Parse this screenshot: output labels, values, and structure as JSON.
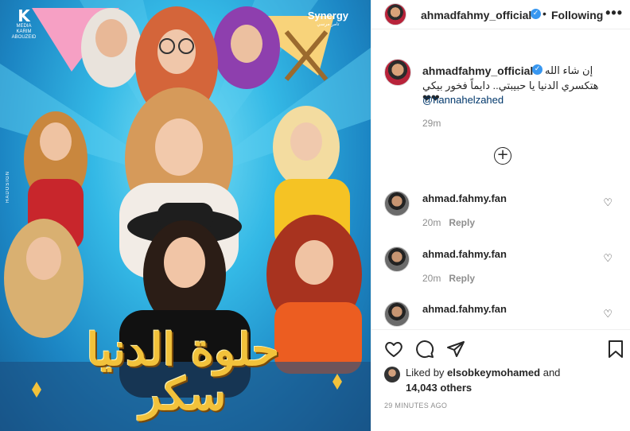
{
  "poster": {
    "brand_left_logo": "K",
    "brand_left_line1": "MEDIA",
    "brand_left_line2": "KARIM ABOUZEID",
    "brand_right_name": "Synergy",
    "brand_right_sub": "تامر مرسي",
    "side_mark": "HADOSIGN",
    "title": "حلوة الدنيا سكر",
    "colors": {
      "sky": "#34b9e6",
      "title_gold": "#f2c23b"
    }
  },
  "header": {
    "username": "ahmadfahmy_official",
    "separator": "•",
    "follow_label": "Following",
    "more_icon": "•••"
  },
  "caption": {
    "username": "ahmadfahmy_official",
    "verified_icon": "✓",
    "line1": "إن شاء الله",
    "line2": "هتكسري الدنيا يا حبيبتي.. دايماً فخور بيكي ❤❤",
    "mention": "@hannahelzahed",
    "time": "29m"
  },
  "load_more_icon": "+",
  "comments": [
    {
      "username": "ahmad.fahmy.fan",
      "text": "",
      "time": "20m",
      "reply": "Reply"
    },
    {
      "username": "ahmad.fahmy.fan",
      "text": "",
      "time": "20m",
      "reply": "Reply"
    },
    {
      "username": "ahmad.fahmy.fan",
      "text": ""
    }
  ],
  "actions": {
    "liked_prefix": "Liked by",
    "liked_user": "elsobkeymohamed",
    "liked_and": "and",
    "likes_count": "14,043 others",
    "post_time": "29 MINUTES AGO"
  }
}
